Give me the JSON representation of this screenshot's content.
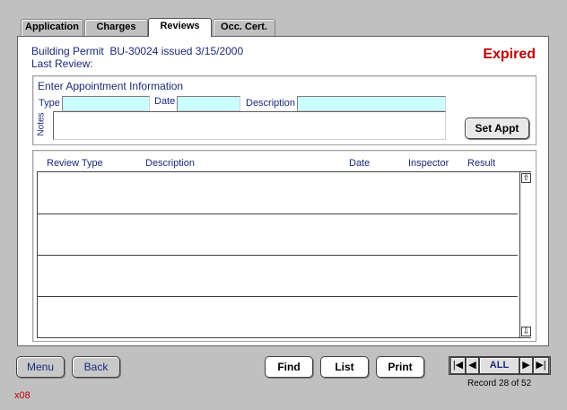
{
  "tabs": [
    {
      "label": "Application"
    },
    {
      "label": "Charges"
    },
    {
      "label": "Reviews"
    },
    {
      "label": "Occ. Cert."
    }
  ],
  "header": {
    "permit_line": "Building Permit  BU-30024 issued 3/15/2000",
    "last_review_label": "Last Review:",
    "status": "Expired"
  },
  "appointment": {
    "section_title": "Enter Appointment Information",
    "type_label": "Type",
    "type_value": "",
    "date_label": "Date",
    "date_value": "",
    "description_label": "Description",
    "description_value": "",
    "notes_label": "Notes",
    "notes_value": "",
    "set_appt_label": "Set Appt"
  },
  "reviews_table": {
    "columns": [
      "Review Type",
      "Description",
      "Date",
      "Inspector",
      "Result"
    ],
    "rows": [
      {
        "review_type": "",
        "description": "",
        "date": "",
        "inspector": "",
        "result": ""
      },
      {
        "review_type": "",
        "description": "",
        "date": "",
        "inspector": "",
        "result": ""
      },
      {
        "review_type": "",
        "description": "",
        "date": "",
        "inspector": "",
        "result": ""
      },
      {
        "review_type": "",
        "description": "",
        "date": "",
        "inspector": "",
        "result": ""
      }
    ]
  },
  "footer": {
    "menu_label": "Menu",
    "back_label": "Back",
    "find_label": "Find",
    "list_label": "List",
    "print_label": "Print",
    "all_label": "ALL",
    "record_text": "Record 28 of 52",
    "screen_code": "x08"
  },
  "colors": {
    "status": "#c00000",
    "label_blue": "#1a2a7a",
    "input_fill": "#ccffff",
    "background": "#c0c0c0"
  }
}
